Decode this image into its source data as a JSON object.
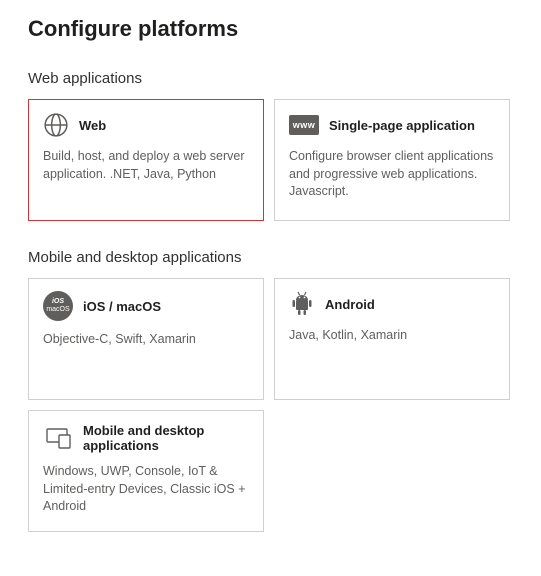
{
  "page_title": "Configure platforms",
  "sections": {
    "web": {
      "title": "Web applications",
      "cards": [
        {
          "title": "Web",
          "desc": "Build, host, and deploy a web server application. .NET, Java, Python"
        },
        {
          "title": "Single-page application",
          "desc": "Configure browser client applications and progressive web applications. Javascript."
        }
      ]
    },
    "mobile": {
      "title": "Mobile and desktop applications",
      "cards": [
        {
          "title": "iOS / macOS",
          "desc": "Objective-C, Swift, Xamarin"
        },
        {
          "title": "Android",
          "desc": "Java, Kotlin, Xamarin"
        },
        {
          "title": "Mobile and desktop applications",
          "desc": "Windows, UWP, Console, IoT & Limited-entry Devices, Classic iOS + Android"
        }
      ]
    }
  },
  "www_label": "www"
}
